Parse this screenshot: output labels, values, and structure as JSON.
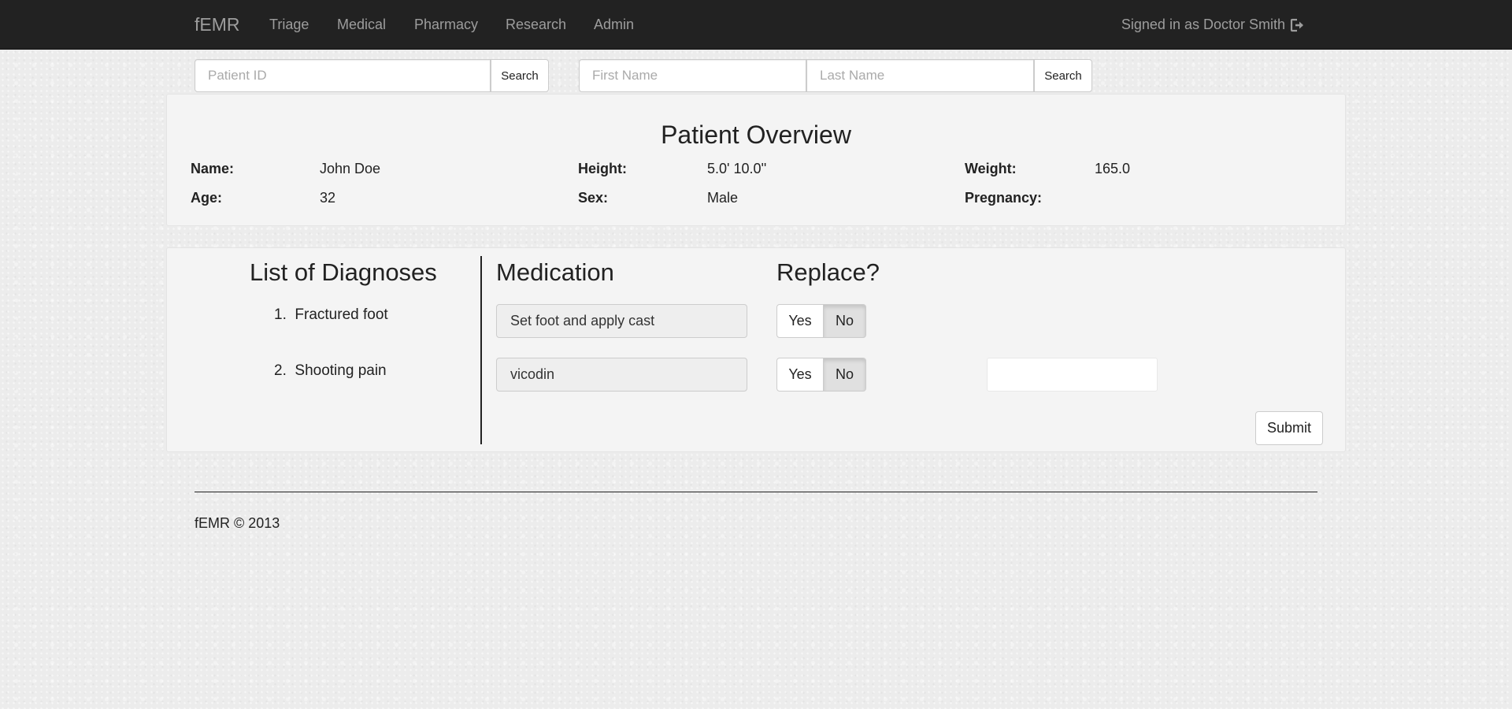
{
  "navbar": {
    "brand": "fEMR",
    "links": [
      "Triage",
      "Medical",
      "Pharmacy",
      "Research",
      "Admin"
    ],
    "signed_in": "Signed in as Doctor Smith"
  },
  "search": {
    "patient_id_placeholder": "Patient ID",
    "search_label": "Search",
    "first_name_placeholder": "First Name",
    "last_name_placeholder": "Last Name"
  },
  "overview": {
    "title": "Patient Overview",
    "labels": {
      "name": "Name:",
      "age": "Age:",
      "height": "Height:",
      "sex": "Sex:",
      "weight": "Weight:",
      "pregnancy": "Pregnancy:"
    },
    "values": {
      "name": "John Doe",
      "age": "32",
      "height": "5.0' 10.0''",
      "sex": "Male",
      "weight": "165.0",
      "pregnancy": ""
    }
  },
  "diagnoses": {
    "heading": "List of Diagnoses",
    "items": [
      "1.  Fractured foot",
      "2.  Shooting pain"
    ]
  },
  "medication": {
    "heading": "Medication",
    "items": [
      "Set foot and apply cast",
      "vicodin"
    ]
  },
  "replace": {
    "heading": "Replace?",
    "yes_label": "Yes",
    "no_label": "No",
    "selected": [
      "No",
      "No"
    ]
  },
  "submit_label": "Submit",
  "footer": {
    "text": "fEMR © 2013"
  }
}
